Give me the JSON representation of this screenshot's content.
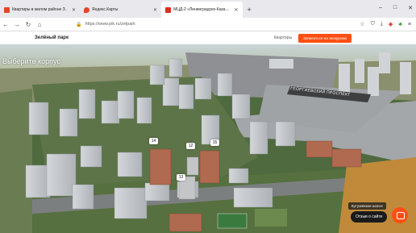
{
  "browser": {
    "tabs": [
      {
        "title": "Квартиры в жилом районе З…",
        "color": "#e4452b",
        "active": false
      },
      {
        "title": "Яндекс.Карты",
        "color": "#e4452b",
        "active": false
      },
      {
        "title": "МЦД-2 «Ленинградско-Каза…",
        "color": "#d8301e",
        "active": true
      }
    ],
    "new_tab": "+",
    "url": "https://www.pik.ru/zelpark",
    "window_controls": [
      "–",
      "□",
      "✕"
    ]
  },
  "site": {
    "project": "Зелёный парк",
    "flats_link": "Квартиры",
    "cta": "Записаться на экскурсию"
  },
  "scene": {
    "title": "Выберите корпус",
    "avenue_sign": "ГЕОРГИЕВСКИЙ ПРОСПЕКТ",
    "markers": [
      "14",
      "12",
      "13",
      "15"
    ],
    "road_label": "Кутузовское шоссе",
    "feedback": "Отзыв о сайте"
  }
}
